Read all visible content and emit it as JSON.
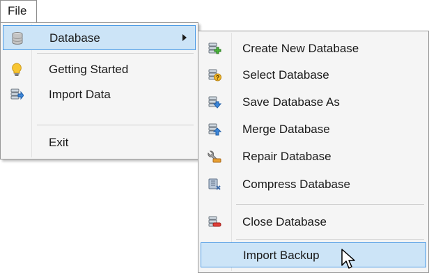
{
  "menubar": {
    "file_label": "File"
  },
  "file_menu": {
    "items": [
      {
        "label": "Database",
        "icon": "database-icon",
        "has_submenu": true,
        "highlighted": true
      },
      {
        "label": "Getting Started",
        "icon": "lightbulb-icon"
      },
      {
        "label": "Import Data",
        "icon": "import-data-icon"
      },
      {
        "label": "Exit"
      }
    ]
  },
  "database_menu": {
    "items": [
      {
        "label": "Create New Database",
        "icon": "create-database-icon"
      },
      {
        "label": "Select Database",
        "icon": "select-database-icon"
      },
      {
        "label": "Save Database As",
        "icon": "save-database-icon"
      },
      {
        "label": "Merge Database",
        "icon": "merge-database-icon"
      },
      {
        "label": "Repair Database",
        "icon": "repair-database-icon"
      },
      {
        "label": "Compress Database",
        "icon": "compress-database-icon"
      },
      {
        "label": "Close Database",
        "icon": "close-database-icon"
      },
      {
        "label": "Import Backup",
        "highlighted": true
      }
    ]
  },
  "colors": {
    "highlight_fill": "#cce4f7",
    "highlight_border": "#4c9ae5",
    "menu_bg": "#f5f5f5"
  }
}
